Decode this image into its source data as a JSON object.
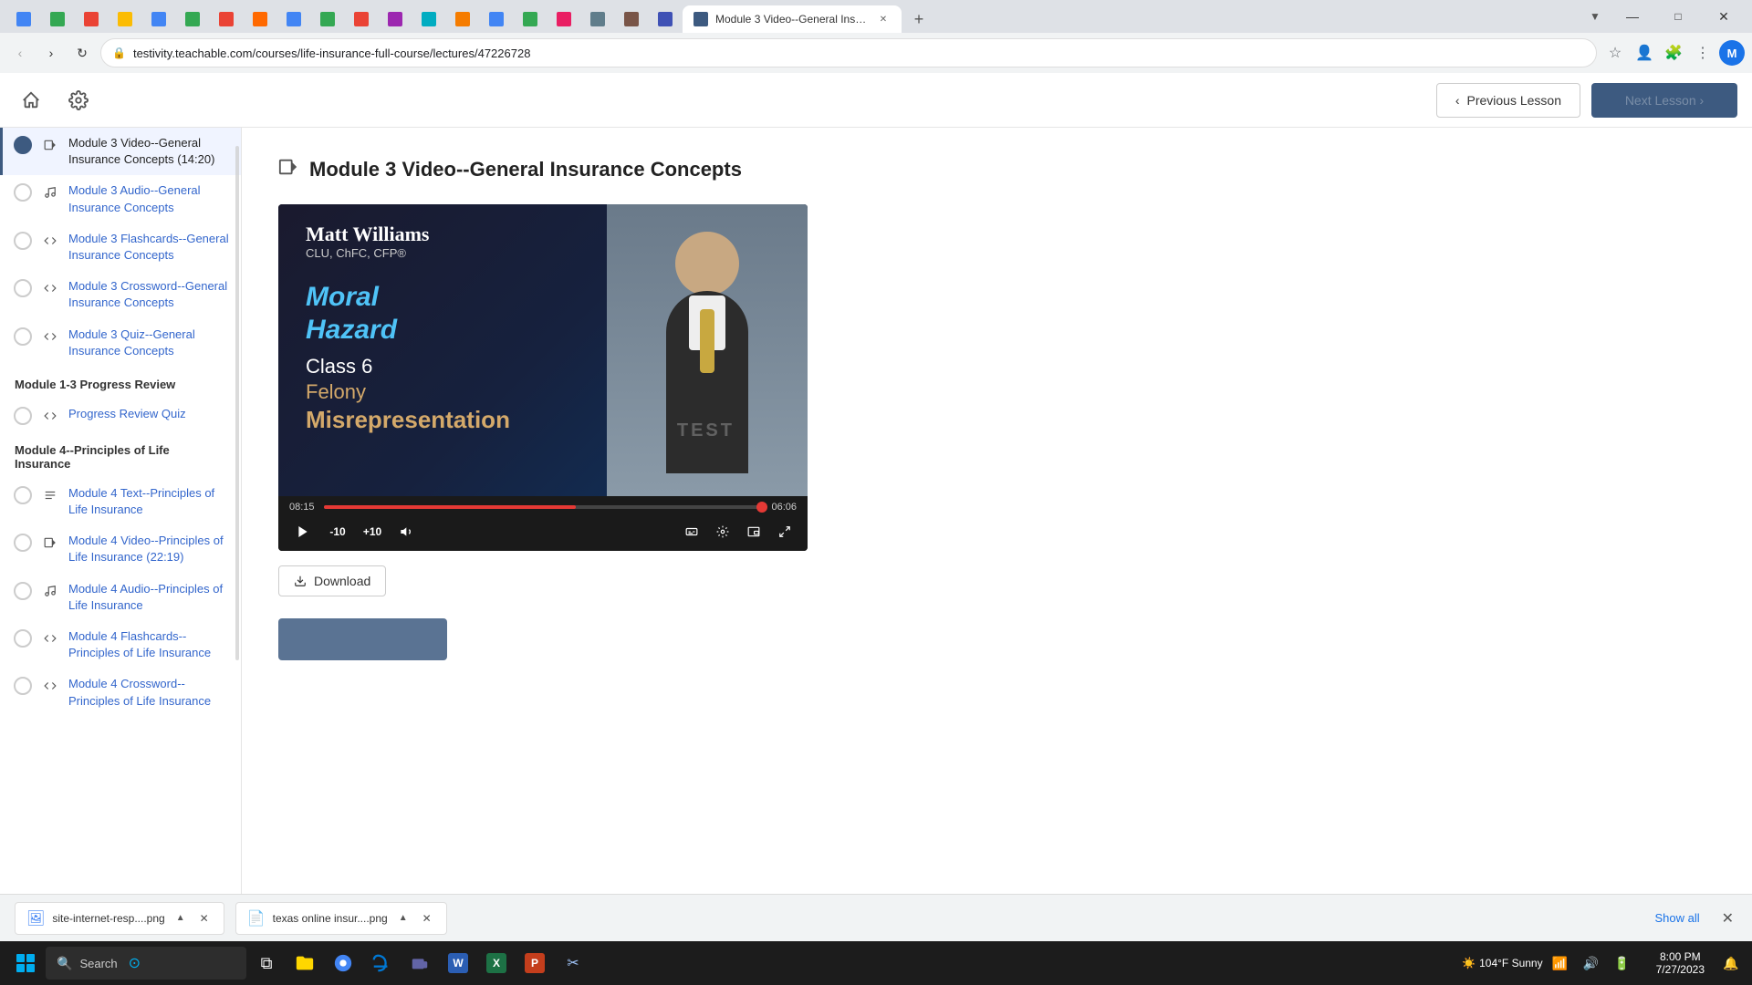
{
  "browser": {
    "url": "testivity.teachable.com/courses/life-insurance-full-course/lectures/47226728",
    "tab_title": "Module 3 Video--General Insurance Concepts",
    "profile_initial": "M"
  },
  "app": {
    "prev_lesson_label": "Previous Lesson",
    "next_lesson_label": ""
  },
  "page": {
    "title": "Module 3 Video--General Insurance Concepts",
    "title_icon": "▶"
  },
  "video": {
    "presenter_name": "Matt Williams",
    "presenter_credentials": "CLU, ChFC, CFP®",
    "keyword1": "Moral",
    "keyword2": "Hazard",
    "keyword3": "Class 6",
    "keyword4": "Felony",
    "keyword5": "Misrepresentation",
    "watermark": "TEST",
    "current_time": "08:15",
    "remaining_time": "06:06",
    "progress_pct": "57.5"
  },
  "sidebar": {
    "section1_title": "",
    "section2_title": "Module 1-3 Progress Review",
    "section3_title": "Module 4--Principles of Life Insurance",
    "items": [
      {
        "id": "mod3-video",
        "label": "Module 3 Video--General Insurance Concepts (14:20)",
        "icon_type": "video",
        "active": true,
        "checked": false
      },
      {
        "id": "mod3-audio",
        "label": "Module 3 Audio--General Insurance Concepts",
        "icon_type": "audio",
        "active": false,
        "checked": false
      },
      {
        "id": "mod3-flash",
        "label": "Module 3 Flashcards--General Insurance Concepts",
        "icon_type": "code",
        "active": false,
        "checked": false
      },
      {
        "id": "mod3-cross",
        "label": "Module 3 Crossword--General Insurance Concepts",
        "icon_type": "code",
        "active": false,
        "checked": false
      },
      {
        "id": "mod3-quiz",
        "label": "Module 3 Quiz--General Insurance Concepts",
        "icon_type": "code",
        "active": false,
        "checked": false
      },
      {
        "id": "progress-quiz",
        "label": "Progress Review Quiz",
        "icon_type": "code",
        "active": false,
        "checked": false,
        "section": 2
      },
      {
        "id": "mod4-text",
        "label": "Module 4 Text--Principles of Life Insurance",
        "icon_type": "text",
        "active": false,
        "checked": false,
        "section": 3
      },
      {
        "id": "mod4-video",
        "label": "Module 4 Video--Principles of Life Insurance (22:19)",
        "icon_type": "video",
        "active": false,
        "checked": false,
        "section": 3
      },
      {
        "id": "mod4-audio",
        "label": "Module 4 Audio--Principles of Life Insurance",
        "icon_type": "audio",
        "active": false,
        "checked": false,
        "section": 3
      },
      {
        "id": "mod4-flash",
        "label": "Module 4 Flashcards--Principles of Life Insurance",
        "icon_type": "code",
        "active": false,
        "checked": false,
        "section": 3
      },
      {
        "id": "mod4-cross",
        "label": "Module 4 Crossword--Principles of Life Insurance",
        "icon_type": "code",
        "active": false,
        "checked": false,
        "section": 3
      }
    ]
  },
  "download_btn_label": "Download",
  "taskbar": {
    "search_placeholder": "Search",
    "time": "8:00 PM",
    "date": "7/27/2023",
    "temperature": "104°F",
    "weather": "Sunny"
  },
  "downloads": [
    {
      "filename": "site-internet-resp....png"
    },
    {
      "filename": "texas online insur....png"
    }
  ],
  "show_all_label": "Show all"
}
